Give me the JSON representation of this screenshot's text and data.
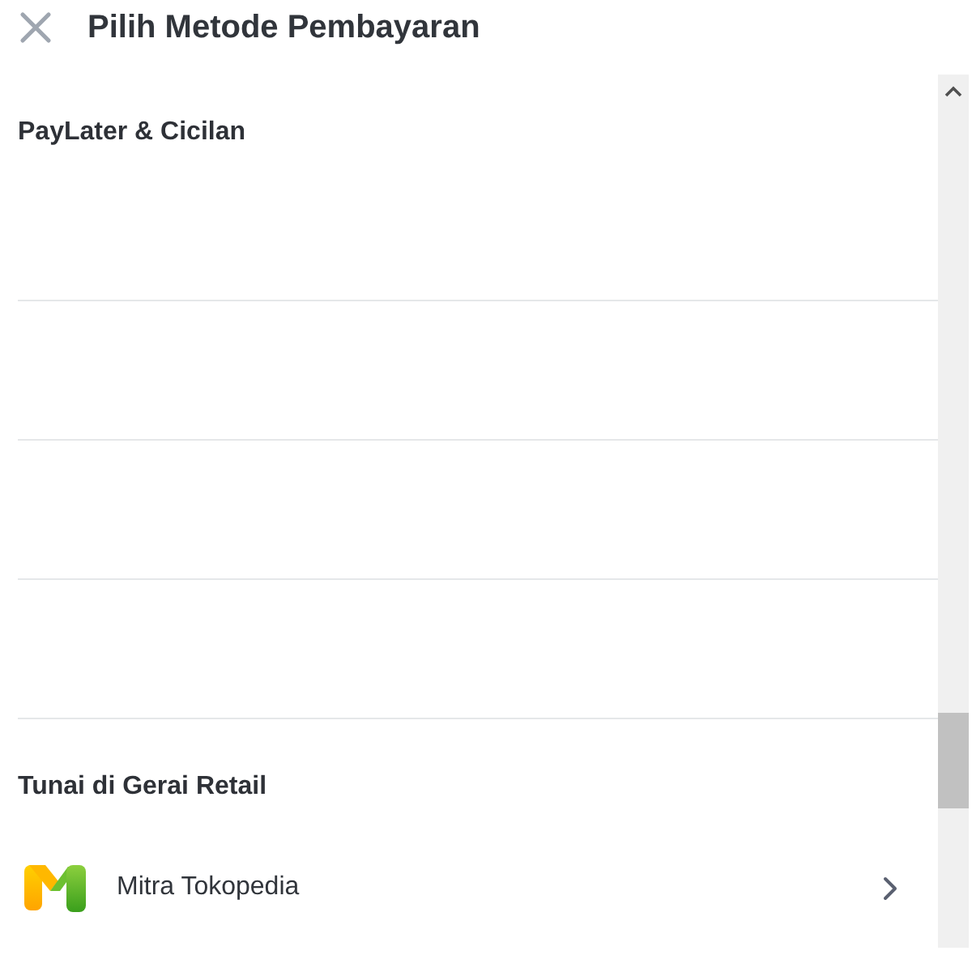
{
  "header": {
    "title": "Pilih Metode Pembayaran"
  },
  "sections": [
    {
      "title": "PayLater & Cicilan"
    },
    {
      "title": "Tunai di Gerai Retail",
      "options": [
        {
          "name": "Mitra Tokopedia"
        }
      ]
    }
  ]
}
